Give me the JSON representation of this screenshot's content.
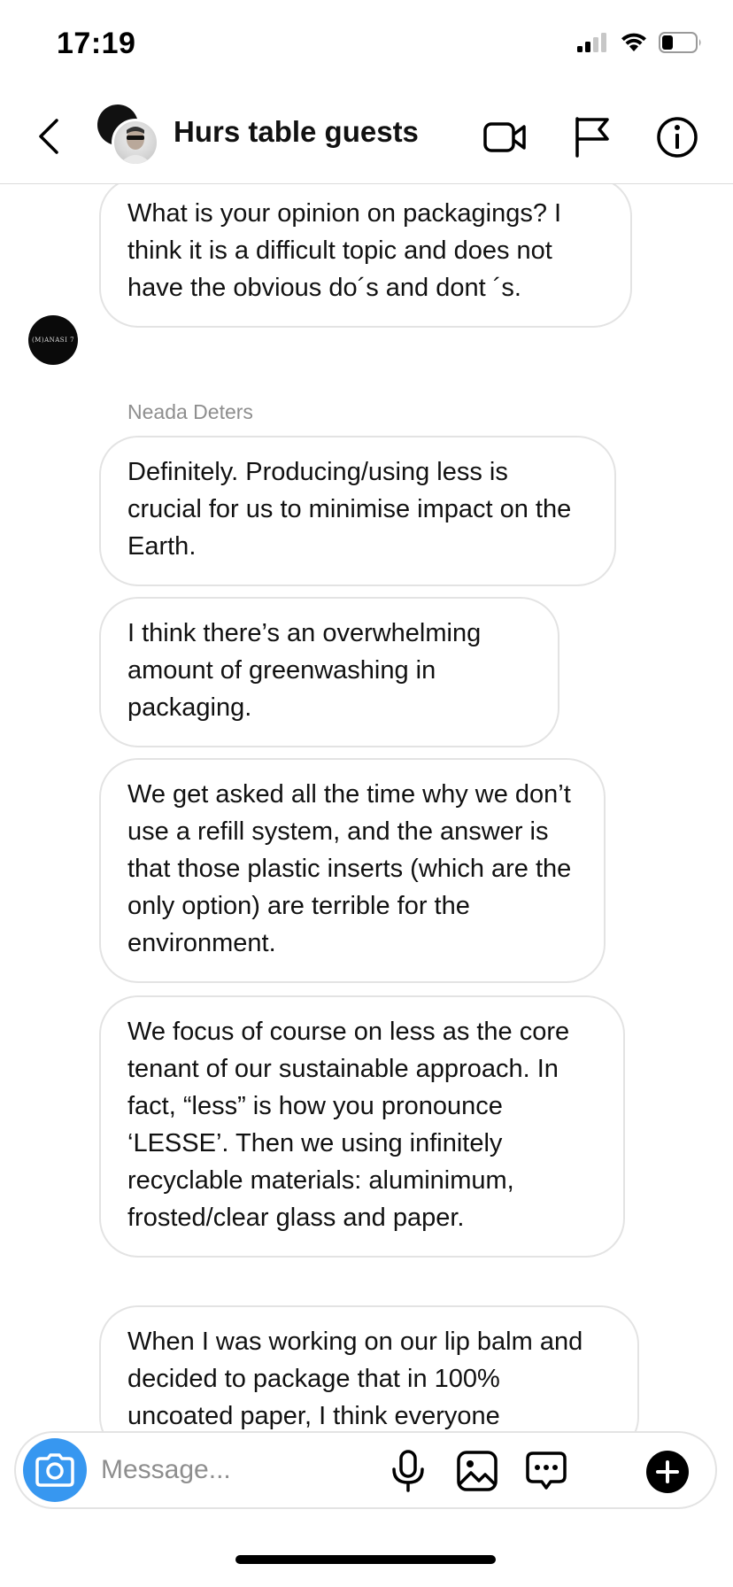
{
  "status_bar": {
    "time": "17:19",
    "icons": [
      "cellular-signal-icon",
      "wifi-icon",
      "battery-icon"
    ]
  },
  "header": {
    "title": "Hurs table guests",
    "icons": [
      "chevron-left-icon",
      "video-camera-icon",
      "flag-icon",
      "info-icon"
    ]
  },
  "chat": {
    "avatar_text": "(M)ANASI 7",
    "sender_name": "Neada Deters",
    "messages": [
      {
        "text": "What is your opinion on packagings? I think it is a difficult topic and does not have the obvious do´s and dont ´s."
      },
      {
        "text": "Definitely. Producing/using less is crucial for us to minimise impact on the Earth."
      },
      {
        "text": "I think there’s an overwhelming amount of greenwashing in packaging."
      },
      {
        "text": "We get asked all the time why we don’t use a refill system, and the answer is that those plastic inserts (which are the only option) are terrible for the environment."
      },
      {
        "text": "We focus of course on less as the core tenant of our sustainable approach. In fact, “less” is how you pronounce ‘LESSE’. Then we using infinitely recyclable materials: aluminimum, frosted/clear glass and paper."
      },
      {
        "text": "When I was working on our lip balm and decided to package that in 100% uncoated paper, I think everyone"
      }
    ]
  },
  "composer": {
    "placeholder": "Message...",
    "icons": [
      "camera-icon",
      "microphone-icon",
      "image-icon",
      "message-options-icon",
      "plus-icon"
    ]
  },
  "colors": {
    "accent": "#3797f0",
    "bubble_border": "#e3e3e3",
    "secondary_text": "#8e8e8e"
  }
}
